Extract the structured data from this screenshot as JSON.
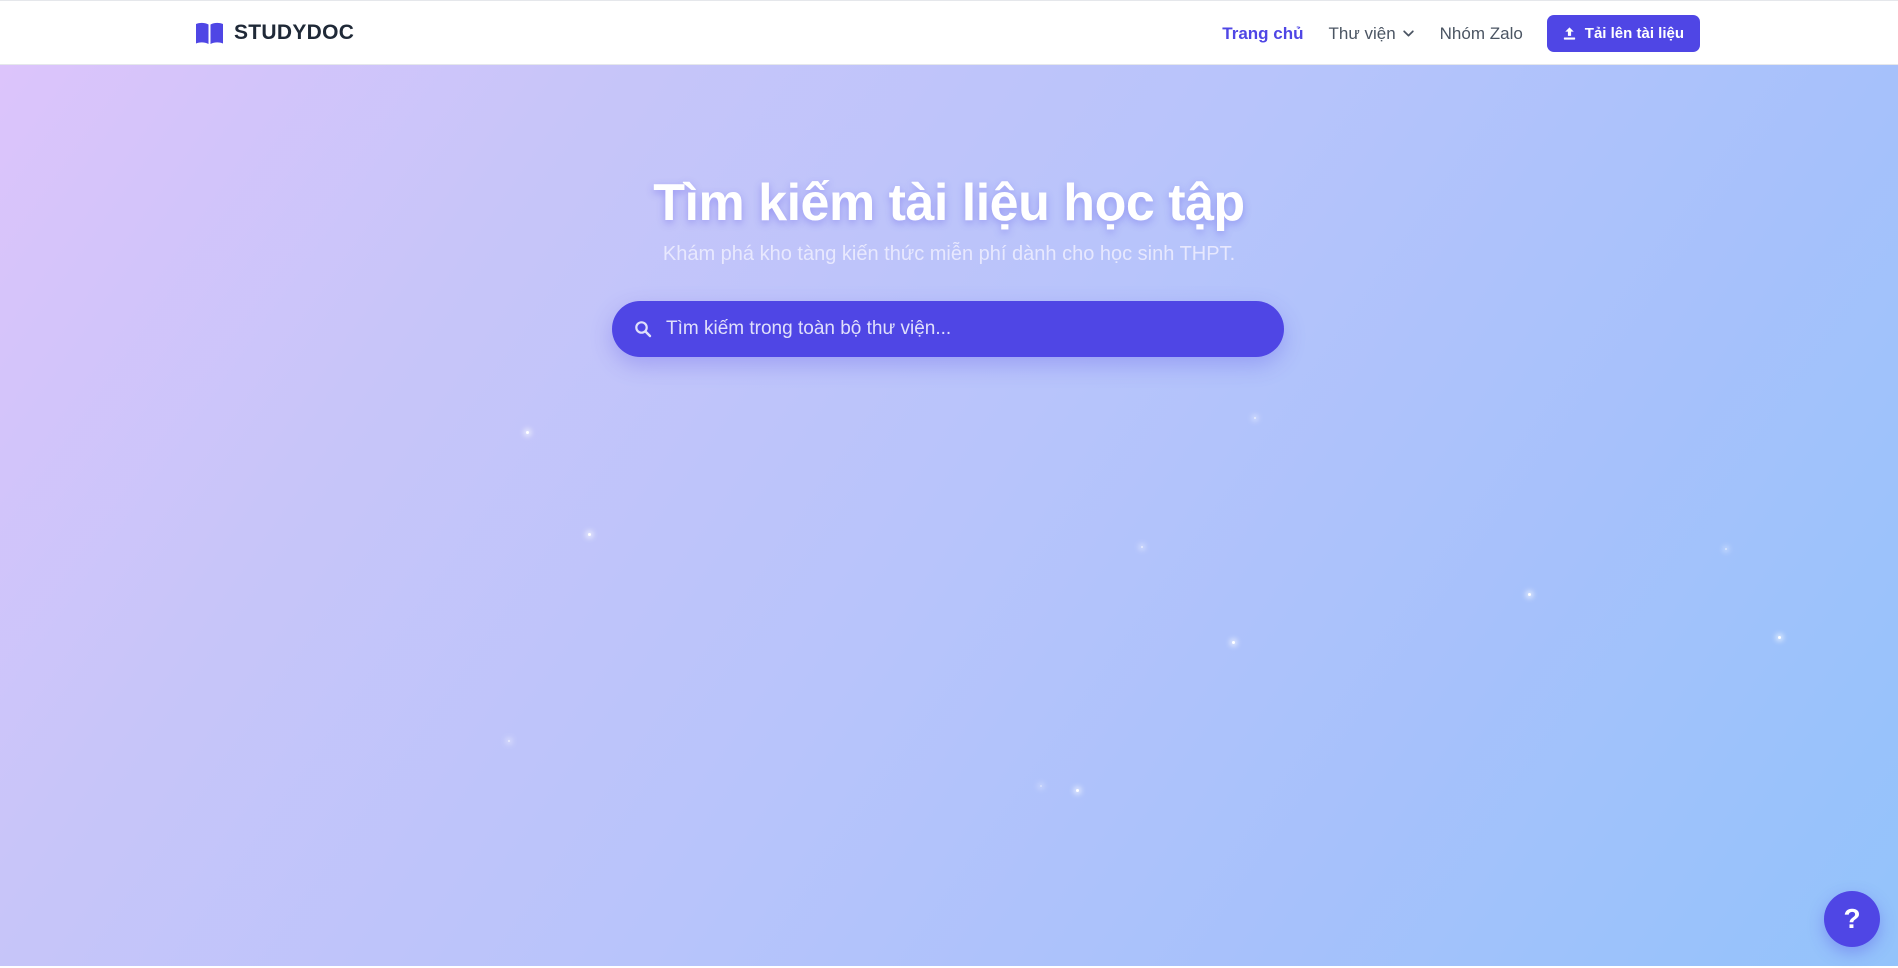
{
  "header": {
    "brand": "STUDYDOC",
    "brand_icon": "open-book-icon",
    "nav": {
      "home": "Trang chủ",
      "library": "Thư viện",
      "zalo": "Nhóm Zalo"
    },
    "upload_label": "Tải lên tài liệu",
    "upload_icon": "upload-icon"
  },
  "hero": {
    "title": "Tìm kiếm tài liệu học tập",
    "subtitle": "Khám phá kho tàng kiến thức miễn phí dành cho học sinh THPT.",
    "search_placeholder": "Tìm kiếm trong toàn bộ thư viện...",
    "search_value": ""
  },
  "help_button": "?",
  "colors": {
    "accent": "#4f46e5",
    "brand_text": "#1f2937",
    "nav_text": "#4b5563",
    "gradient_start": "#dcc4fb",
    "gradient_end": "#93c3fb"
  }
}
